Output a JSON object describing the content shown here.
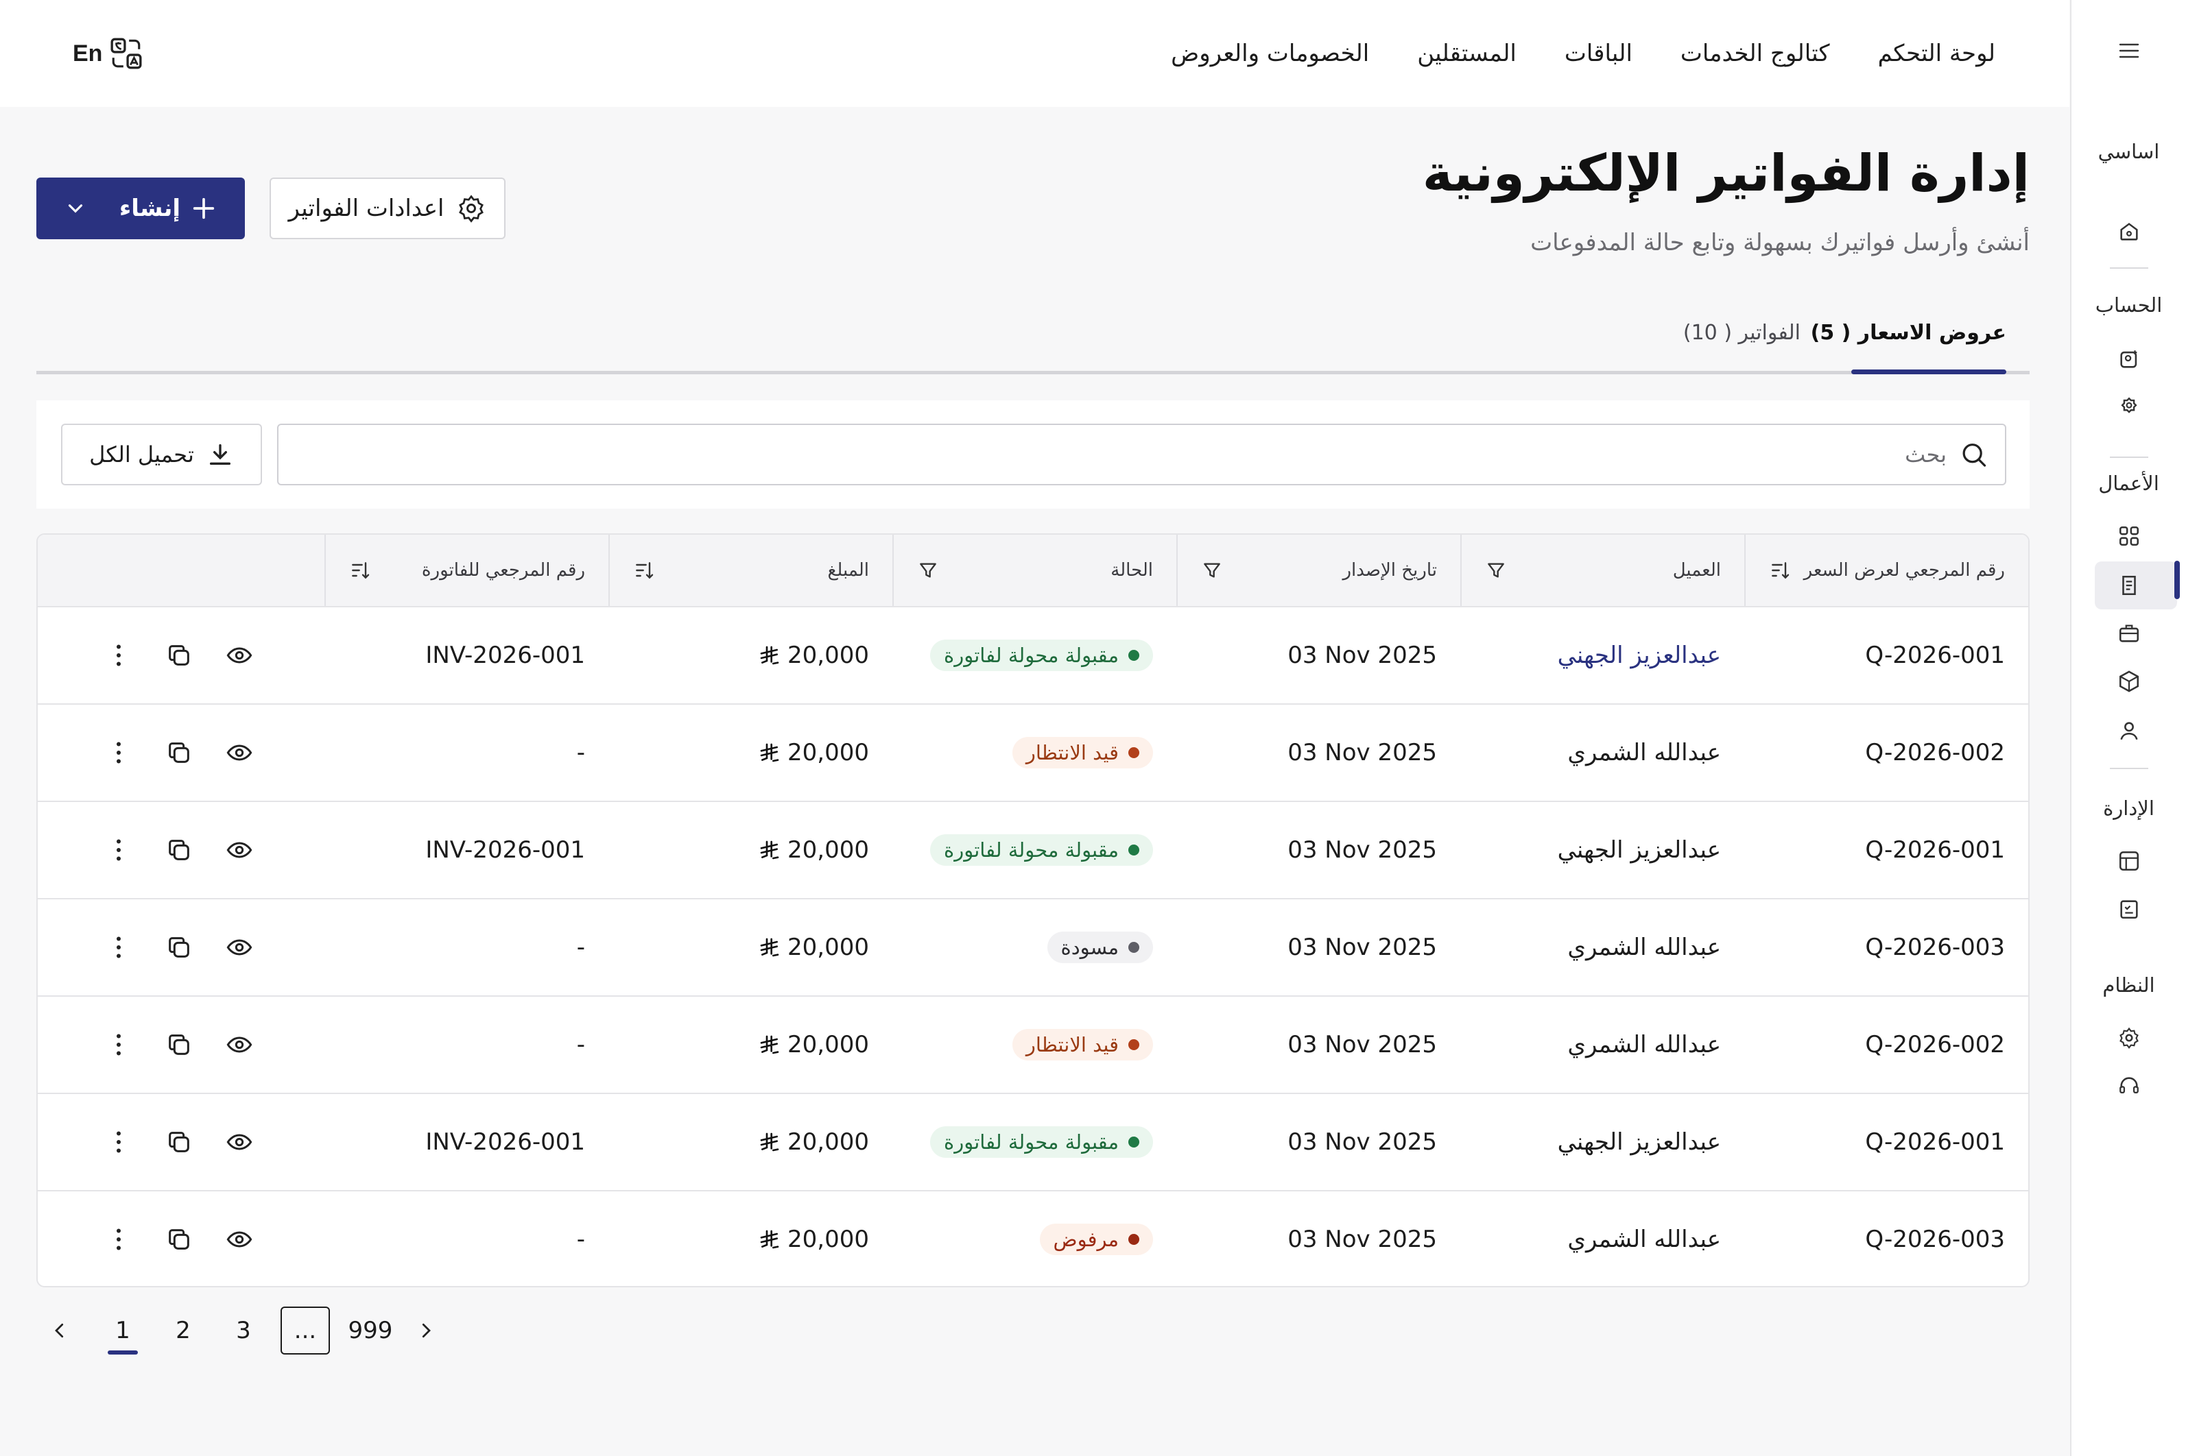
{
  "nav": {
    "items": [
      "لوحة التحكم",
      "كتالوج الخدمات",
      "الباقات",
      "المستقلين",
      "الخصومات والعروض"
    ],
    "lang_label": "En"
  },
  "sidebar": {
    "sections": [
      {
        "label": "اساسي",
        "icons": [
          "home-icon"
        ]
      },
      {
        "label": "الحساب",
        "icons": [
          "account-badge-icon",
          "account-settings-icon"
        ]
      },
      {
        "label": "الأعمال",
        "icons": [
          "grid-icon",
          "invoice-icon",
          "briefcase-icon",
          "box-icon",
          "users-icon"
        ]
      },
      {
        "label": "الإدارة",
        "icons": [
          "layout-icon",
          "checklist-icon"
        ]
      },
      {
        "label": "النظام",
        "icons": [
          "gear-icon",
          "headset-icon"
        ]
      }
    ],
    "active_icon": "invoice-icon"
  },
  "page": {
    "title": "إدارة الفواتير الإلكترونية",
    "subtitle": "أنشئ وأرسل فواتيرك بسهولة وتابع حالة المدفوعات",
    "create_label": "إنشاء",
    "settings_label": "اعدادات الفواتير"
  },
  "tabs": [
    {
      "label": "عروض الاسعار ( 5)",
      "active": true
    },
    {
      "label": "الفواتير ( 10)",
      "active": false
    }
  ],
  "search": {
    "placeholder": "بحث",
    "value": "",
    "download_label": "تحميل الكل"
  },
  "table": {
    "headers": {
      "ref": "رقم المرجعي لعرض السعر",
      "client": "العميل",
      "date": "تاريخ الإصدار",
      "status": "الحالة",
      "amount": "المبلغ",
      "invoice_ref": "رقم المرجعي للفاتورة"
    },
    "rows": [
      {
        "ref": "Q-2026-001",
        "client": "عبدالعزيز الجهني",
        "client_link": true,
        "date": "03 Nov 2025",
        "status": "مقبولة محولة لفاتورة",
        "status_kind": "accepted",
        "amount": "20,000",
        "invoice_ref": "INV-2026-001"
      },
      {
        "ref": "Q-2026-002",
        "client": "عبدالله الشمري",
        "client_link": false,
        "date": "03 Nov 2025",
        "status": "قيد الانتظار",
        "status_kind": "pending",
        "amount": "20,000",
        "invoice_ref": "-"
      },
      {
        "ref": "Q-2026-001",
        "client": "عبدالعزيز الجهني",
        "client_link": false,
        "date": "03 Nov 2025",
        "status": "مقبولة محولة لفاتورة",
        "status_kind": "accepted",
        "amount": "20,000",
        "invoice_ref": "INV-2026-001"
      },
      {
        "ref": "Q-2026-003",
        "client": "عبدالله الشمري",
        "client_link": false,
        "date": "03 Nov 2025",
        "status": "مسودة",
        "status_kind": "draft",
        "amount": "20,000",
        "invoice_ref": "-"
      },
      {
        "ref": "Q-2026-002",
        "client": "عبدالله الشمري",
        "client_link": false,
        "date": "03 Nov 2025",
        "status": "قيد الانتظار",
        "status_kind": "pending",
        "amount": "20,000",
        "invoice_ref": "-"
      },
      {
        "ref": "Q-2026-001",
        "client": "عبدالعزيز الجهني",
        "client_link": false,
        "date": "03 Nov 2025",
        "status": "مقبولة محولة لفاتورة",
        "status_kind": "accepted",
        "amount": "20,000",
        "invoice_ref": "INV-2026-001"
      },
      {
        "ref": "Q-2026-003",
        "client": "عبدالله الشمري",
        "client_link": false,
        "date": "03 Nov 2025",
        "status": "مرفوض",
        "status_kind": "rejected",
        "amount": "20,000",
        "invoice_ref": "-"
      }
    ]
  },
  "pagination": {
    "pages": [
      "1",
      "2",
      "3",
      "...",
      "999"
    ],
    "current": "1"
  },
  "colors": {
    "primary": "#2A3280",
    "accepted": "#1F7A45",
    "pending": "#B2401A",
    "draft": "#5E5E66",
    "rejected": "#9A2A13"
  }
}
